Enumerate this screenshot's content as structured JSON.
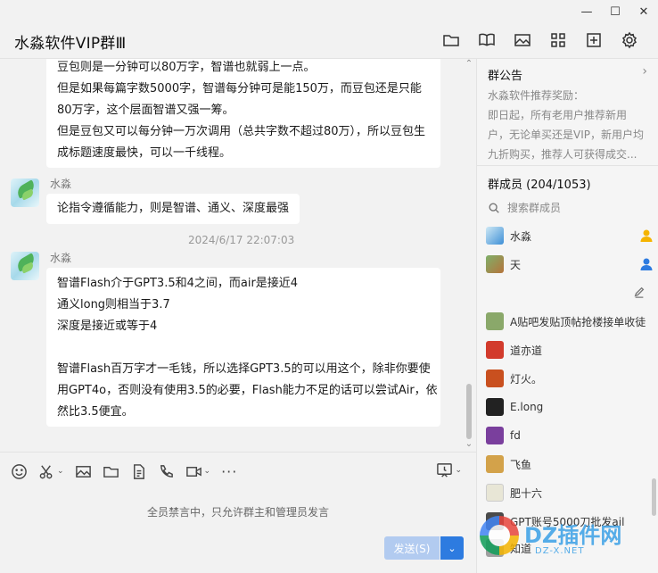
{
  "window": {
    "title": "水淼软件VIP群Ⅲ",
    "controls": [
      "minimize",
      "maximize",
      "close"
    ]
  },
  "toolbar_icons": [
    "folder-icon",
    "book-icon",
    "image-icon",
    "apps-icon",
    "add-window-icon",
    "settings-icon"
  ],
  "messages": [
    {
      "lines": [
        "豆包则是一分钟可以80万字，智谱也就弱上一点。",
        "但是如果每篇字数5000字，智谱每分钟可是能150万，而豆包还是只能",
        "80万字，这个层面智谱又强一筹。",
        "但是豆包又可以每分钟一万次调用（总共字数不超过80万），所以豆包生",
        "成标题速度最快，可以一千线程。"
      ]
    },
    {
      "sender": "水淼",
      "lines": [
        "论指令遵循能力，则是智谱、通义、深度最强"
      ]
    },
    {
      "sender": "水淼",
      "timestamp": "2024/6/17 22:07:03",
      "lines": [
        "智谱Flash介于GPT3.5和4之间，而air是接近4",
        "通义long则相当于3.7",
        "深度是接近或等于4",
        "",
        "智谱Flash百万字才一毛钱，所以选择GPT3.5的可以用这个，除非你要使",
        "用GPT4o，否则没有使用3.5的必要，Flash能力不足的话可以尝试Air，依",
        "然比3.5便宜。"
      ]
    }
  ],
  "input": {
    "mute_notice": "全员禁言中，只允许群主和管理员发言",
    "send_label": "发送(S)",
    "tools": [
      "emoji-icon",
      "scissors-icon",
      "image-icon",
      "folder-icon",
      "doc-icon",
      "phone-icon",
      "video-icon",
      "more-icon"
    ]
  },
  "announcement": {
    "title": "群公告",
    "lines": [
      "水淼软件推荐奖励：",
      "即日起，所有老用户推荐新用",
      "户，无论单买还是VIP，新用户均",
      "九折购买，推荐人可获得成交..."
    ]
  },
  "members": {
    "title": "群成员 (204/1053)",
    "search_placeholder": "搜索群成员",
    "list": [
      {
        "name": "水淼",
        "role": "owner",
        "color": "#3d8fd6"
      },
      {
        "name": "天",
        "role": "admin",
        "color": "#b5733a"
      },
      {
        "name": "A贴吧发贴顶帖抢楼接单收徒",
        "color": "#8aa86a"
      },
      {
        "name": "道亦道",
        "color": "#d23b2c"
      },
      {
        "name": "灯火。",
        "color": "#c9501f"
      },
      {
        "name": "E.long",
        "color": "#222222"
      },
      {
        "name": "fd",
        "color": "#7a3f9d"
      },
      {
        "name": "飞鱼",
        "color": "#d3a24a"
      },
      {
        "name": "肥十六",
        "color": "#e8e6d6"
      },
      {
        "name": "GPT账号5000刀批发ail",
        "color": "#4a4a4a"
      },
      {
        "name": "知道",
        "color": "#a0a0a0"
      }
    ]
  },
  "watermark": {
    "text": "DZ插件网",
    "sub": "DZ-X.NET"
  }
}
